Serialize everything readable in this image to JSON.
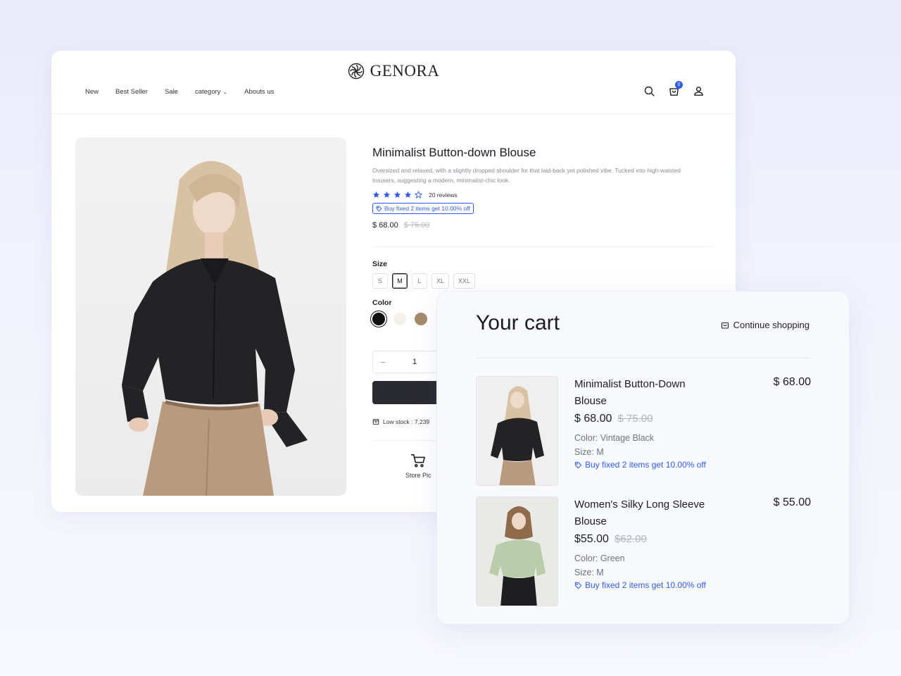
{
  "brand": {
    "name": "GENORA"
  },
  "nav": {
    "items": [
      "New",
      "Best Seller",
      "Sale",
      "category",
      "Abouts us"
    ]
  },
  "header": {
    "cart_count": "0"
  },
  "product": {
    "title": "Minimalist Button-down Blouse",
    "description": "Oversized and relaxed, with a slightly dropped shoulder for that laid-back yet polished vibe. Tucked into high-waisted trousers, suggesting a modern, minimalist-chic look.",
    "rating": 4,
    "reviews": "20 reviews",
    "promo": "Buy fixed 2 items get 10.00% off",
    "price": "$ 68.00",
    "price_old": "$ 75.00",
    "size_label": "Size",
    "sizes": [
      "S",
      "M",
      "L",
      "XL",
      "XXL"
    ],
    "selected_size": "M",
    "color_label": "Color",
    "colors": [
      "#111111",
      "#f3f1ec",
      "#a88a6a"
    ],
    "quantity": "1",
    "qty_minus": "−",
    "qty_plus": "+",
    "stock": "Low stock : 7,239",
    "pickup": "Store Pic"
  },
  "cart": {
    "title": "Your cart",
    "continue_label": "Continue shopping",
    "items": [
      {
        "name": "Minimalist Button-Down Blouse",
        "price": "$ 68.00",
        "price_old": "$ 75.00",
        "color": "Color: Vintage Black",
        "size": "Size: M",
        "promo": "Buy fixed 2 items get 10.00% off",
        "total": "$ 68.00"
      },
      {
        "name": "Women's Silky Long Sleeve Blouse",
        "price": "$55.00",
        "price_old": "$62.00",
        "color": "Color: Green",
        "size": "Size: M",
        "promo": "Buy fixed 2 items get 10.00% off",
        "total": "$ 55.00"
      }
    ]
  },
  "colors": {
    "accent": "#2f5bea",
    "dark_button": "#2a2b30"
  }
}
